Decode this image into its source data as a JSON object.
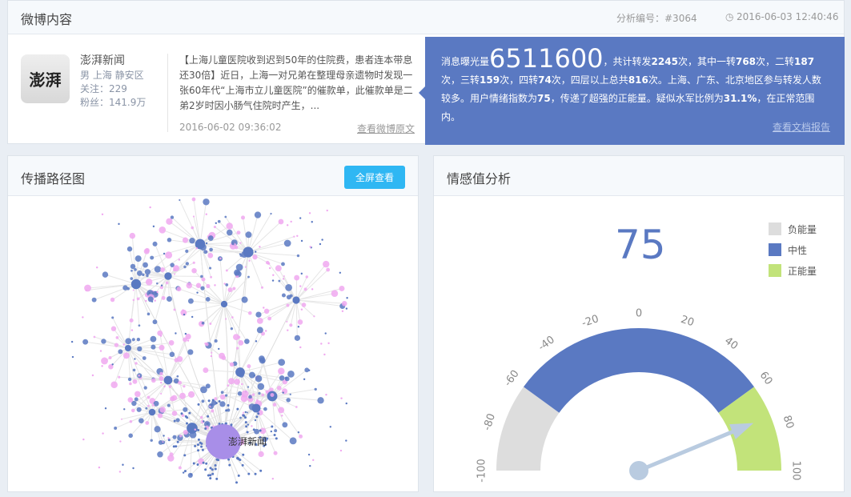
{
  "header": {
    "title": "微博内容",
    "analysis_id": "分析编号：#3064",
    "timestamp": "2016-06-03 12:40:46"
  },
  "user": {
    "avatar_text": "澎湃",
    "name": "澎湃新闻",
    "location": "男 上海 静安区",
    "following": "关注：229",
    "followers": "粉丝：141.9万"
  },
  "post": {
    "text": "【上海儿童医院收到迟到50年的住院费，患者连本带息还30倍】近日，上海一对兄弟在整理母亲遗物时发现一张60年代“上海市立儿童医院”的催款单，此催款单是二弟2岁时因小肠气住院时产生，...",
    "time": "2016-06-02 09:36:02",
    "link": "查看微博原文"
  },
  "summary": {
    "p1": "消息曝光量",
    "exposure": "6511600",
    "p2": "，共计转发",
    "total": "2245",
    "p3": "次，其中一转",
    "l1": "768",
    "p4": "次，二转",
    "l2": "187",
    "p5": "次，三转",
    "l3": "159",
    "p6": "次，四转",
    "l4": "74",
    "p7": "次，四层以上总共",
    "l5": "816",
    "p8": "次。上海、广东、北京地区参与转发人数较多。用户情绪指数为",
    "mood": "75",
    "p9": "，传递了超强的正能量。疑似水军比例为",
    "ratio": "31.1%",
    "p10": "，在正常范围内。",
    "link": "查看文档报告"
  },
  "propagation": {
    "title": "传播路径图",
    "fullscreen": "全屏查看",
    "root_label": "澎湃新闻"
  },
  "sentiment": {
    "title": "情感值分析",
    "value": 75,
    "value_text": "75",
    "legend": [
      {
        "label": "负能量",
        "color": "#dddddd"
      },
      {
        "label": "中性",
        "color": "#5a79c2"
      },
      {
        "label": "正能量",
        "color": "#c2e37a"
      }
    ],
    "bands": [
      {
        "from": -100,
        "to": -60,
        "color": "#dddddd"
      },
      {
        "from": -60,
        "to": 60,
        "color": "#5a79c2"
      },
      {
        "from": 60,
        "to": 100,
        "color": "#c2e37a"
      }
    ],
    "ticks": [
      "-100",
      "-80",
      "-60",
      "-40",
      "-20",
      "0",
      "20",
      "40",
      "60",
      "80",
      "100"
    ],
    "min": -100,
    "max": 100,
    "needle_color": "#b9cbe0"
  }
}
